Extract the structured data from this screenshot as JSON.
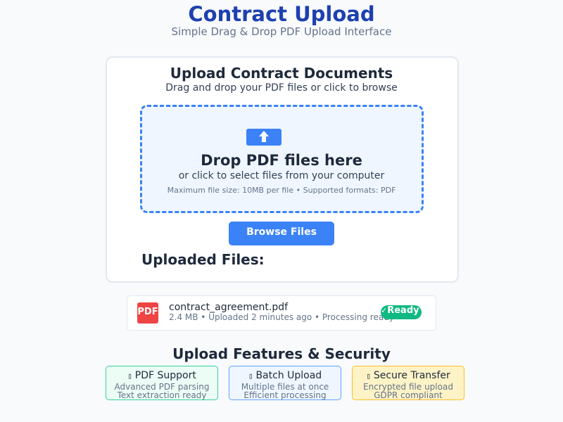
{
  "header": {
    "title": "Contract Upload",
    "subtitle": "Simple Drag & Drop PDF Upload Interface"
  },
  "upload_card": {
    "title": "Upload Contract Documents",
    "subtitle": "Drag and drop your PDF files or click to browse",
    "dropzone": {
      "icon": "upload-arrow-icon",
      "title": "Drop PDF files here",
      "subtitle": "or click to select files from your computer",
      "hint": "Maximum file size: 10MB per file • Supported formats: PDF"
    },
    "browse_label": "Browse Files",
    "uploaded_label": "Uploaded Files:"
  },
  "files": [
    {
      "badge": "PDF",
      "name": "contract_agreement.pdf",
      "meta": "2.4 MB • Uploaded 2 minutes ago • Processing ready",
      "status": "Ready",
      "status_color": "#10b981"
    }
  ],
  "features": {
    "title": "Upload Features & Security",
    "items": [
      {
        "title": "PDF Support",
        "lines": [
          "Advanced PDF parsing",
          "Text extraction ready"
        ],
        "color": "#34d399"
      },
      {
        "title": "Batch Upload",
        "lines": [
          "Multiple files at once",
          "Efficient processing"
        ],
        "color": "#60a5fa"
      },
      {
        "title": "Secure Transfer",
        "lines": [
          "Encrypted file upload",
          "GDPR compliant"
        ],
        "color": "#fbbf24"
      }
    ]
  },
  "colors": {
    "accent": "#3b82f6",
    "title": "#1e40af",
    "pdf_badge": "#ef4444",
    "success": "#10b981"
  }
}
